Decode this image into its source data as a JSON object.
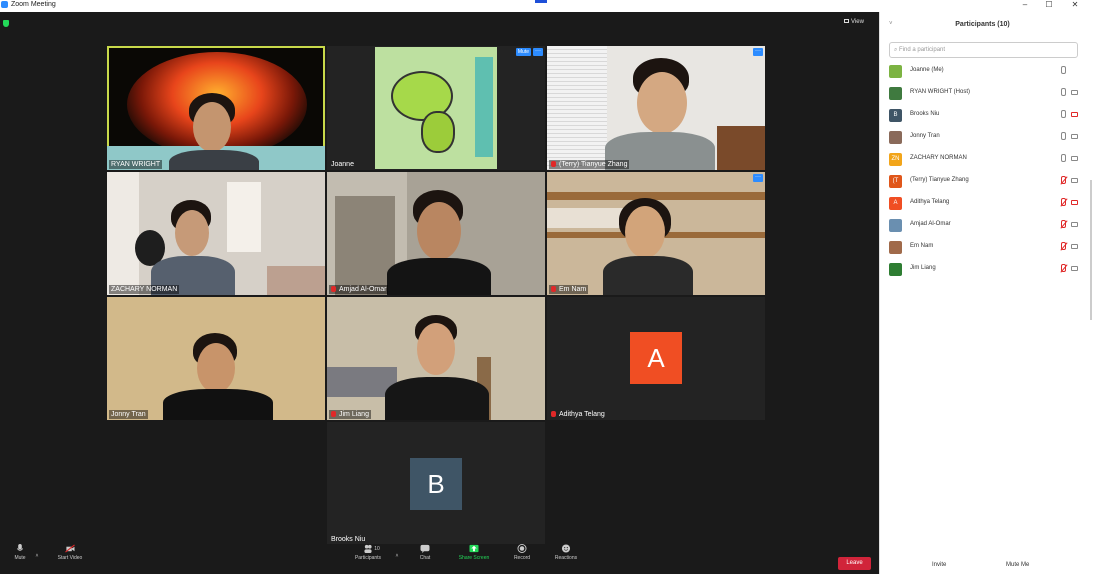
{
  "window": {
    "title": "Zoom Meeting",
    "minimize": "–",
    "maximize": "☐",
    "close": "✕"
  },
  "header": {
    "view_label": "View"
  },
  "tiles": {
    "ryan": "RYAN WRIGHT",
    "joanne": "Joanne",
    "terry": "(Terry) Tianyue Zhang",
    "zachary": "ZACHARY NORMAN",
    "amjad": "Amjad Al-Omar",
    "em": "Em Nam",
    "jonny": "Jonny Tran",
    "jim": "Jim Liang",
    "adithya": "Adithya Telang",
    "adithya_initial": "A",
    "brooks": "Brooks Niu",
    "brooks_initial": "B",
    "mute_label": "Mute",
    "more_label": "···"
  },
  "toolbar": {
    "mute": "Mute",
    "start_video": "Start Video",
    "participants": "Participants",
    "participants_count": "10",
    "chat": "Chat",
    "share_screen": "Share Screen",
    "record": "Record",
    "reactions": "Reactions",
    "leave": "Leave"
  },
  "panel": {
    "title": "Participants (10)",
    "search_placeholder": "Find a participant",
    "invite": "Invite",
    "mute_me": "Mute Me",
    "participants": [
      {
        "name": "Joanne (Me)",
        "initials": "",
        "color": "#7cb342",
        "mic_muted": false,
        "cam_off": false
      },
      {
        "name": "RYAN WRIGHT (Host)",
        "initials": "",
        "color": "#3f7a3f",
        "mic_muted": false,
        "cam_off": false
      },
      {
        "name": "Brooks Niu",
        "initials": "B",
        "color": "#3f5566",
        "mic_muted": false,
        "cam_off": true
      },
      {
        "name": "Jonny Tran",
        "initials": "",
        "color": "#8a6a5a",
        "mic_muted": false,
        "cam_off": false
      },
      {
        "name": "ZACHARY NORMAN",
        "initials": "ZN",
        "color": "#f2a51a",
        "mic_muted": false,
        "cam_off": false
      },
      {
        "name": "(Terry) Tianyue Zhang",
        "initials": "(T",
        "color": "#e0561a",
        "mic_muted": true,
        "cam_off": false
      },
      {
        "name": "Adithya Telang",
        "initials": "A",
        "color": "#f04e23",
        "mic_muted": true,
        "cam_off": true
      },
      {
        "name": "Amjad Al-Omar",
        "initials": "",
        "color": "#6a8fb0",
        "mic_muted": true,
        "cam_off": false
      },
      {
        "name": "Em Nam",
        "initials": "",
        "color": "#a06a4a",
        "mic_muted": true,
        "cam_off": false
      },
      {
        "name": "Jim Liang",
        "initials": "",
        "color": "#2e7d32",
        "mic_muted": true,
        "cam_off": false
      }
    ]
  }
}
